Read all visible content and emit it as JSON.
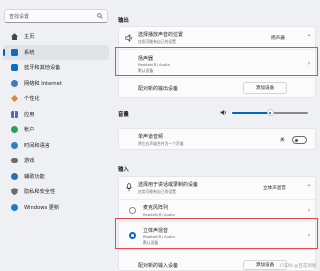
{
  "sidebar": {
    "search_placeholder": "查找设置",
    "items": [
      {
        "label": "主页",
        "icon": "home-icon",
        "color": "#3b3b3b"
      },
      {
        "label": "系统",
        "icon": "system-icon",
        "color": "#0a6fc2",
        "active": true
      },
      {
        "label": "蓝牙和其他设备",
        "icon": "bluetooth-icon",
        "color": "#0a6fc2"
      },
      {
        "label": "网络和 Internet",
        "icon": "network-icon",
        "color": "#3c7dc4"
      },
      {
        "label": "个性化",
        "icon": "brush-icon",
        "color": "#e0863a"
      },
      {
        "label": "应用",
        "icon": "apps-icon",
        "color": "#5a6aa8"
      },
      {
        "label": "帐户",
        "icon": "account-icon",
        "color": "#2f9e57"
      },
      {
        "label": "时间和语言",
        "icon": "clock-icon",
        "color": "#2b82c8"
      },
      {
        "label": "游戏",
        "icon": "game-icon",
        "color": "#6b6b6b"
      },
      {
        "label": "辅助功能",
        "icon": "accessibility-icon",
        "color": "#2d6fb7"
      },
      {
        "label": "隐私和安全性",
        "icon": "shield-icon",
        "color": "#6b6b6b"
      },
      {
        "label": "Windows 更新",
        "icon": "update-icon",
        "color": "#1f7ad0"
      }
    ]
  },
  "main": {
    "output": {
      "heading": "输出",
      "choose_title": "选择播放声音的位置",
      "choose_sub": "应用可能有自己的设置",
      "choose_value": "扬声器",
      "device_title": "扬声器",
      "device_sub1": "Realtek(R) Audio",
      "device_sub2": "默认设备",
      "pair_label": "配对新的输出设备",
      "add_button": "添加设备"
    },
    "volume": {
      "heading": "音量",
      "mono_title": "单声道音频",
      "mono_sub": "将左右声道合并为一个声道",
      "mono_state": "关"
    },
    "input": {
      "heading": "输入",
      "choose_title": "选择用于讲话或录制的设备",
      "choose_sub": "应用可能有自己的设置",
      "choose_value": "立体声混音",
      "dev1_title": "麦克风阵列",
      "dev1_sub": "Realtek(R) Audio",
      "dev2_title": "立体声混音",
      "dev2_sub1": "Realtek(R) Audio",
      "dev2_sub2": "默认设备",
      "pair_label": "配对新的输入设备",
      "add_button": "添加设备"
    }
  },
  "watermark": "CSDN @百花凋谢",
  "colors": {
    "accent": "#0067c0",
    "highlight": "#e84848"
  },
  "levels": {
    "volume_fraction": 0.5
  }
}
